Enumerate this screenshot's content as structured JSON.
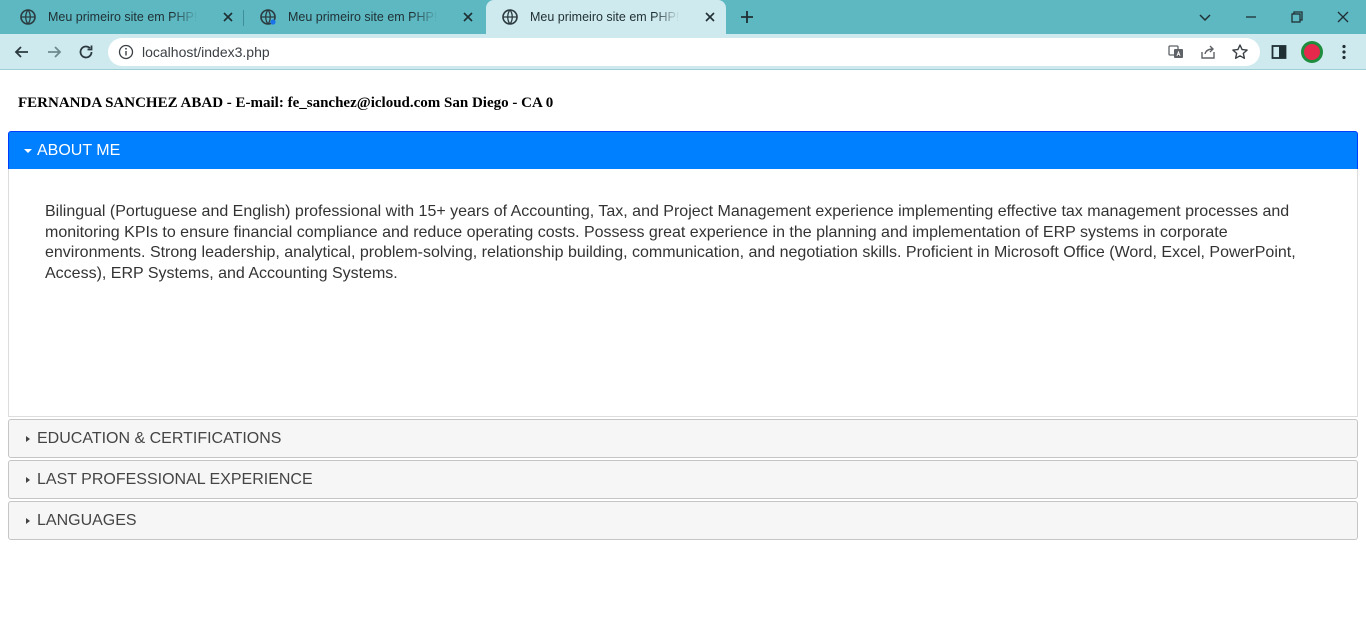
{
  "browser": {
    "tabs": [
      {
        "title": "Meu primeiro site em PHP! Wooh",
        "active": false
      },
      {
        "title": "Meu primeiro site em PHP! Wooh",
        "active": false
      },
      {
        "title": "Meu primeiro site em PHP! Wooh",
        "active": true
      }
    ],
    "address": "localhost/index3.php",
    "colors": {
      "tabstrip": "#5db8c2",
      "toolbar": "#cfeaee"
    }
  },
  "page": {
    "header": "FERNANDA SANCHEZ ABAD - E-mail: fe_sanchez@icloud.com San Diego - CA 0",
    "accordion": [
      {
        "title": "ABOUT ME",
        "expanded": true,
        "content": "Bilingual (Portuguese and English) professional with 15+ years of Accounting, Tax, and Project Management experience implementing effective tax management processes and monitoring KPIs to ensure financial compliance and reduce operating costs. Possess great experience in the planning and implementation of ERP systems in corporate environments. Strong leadership, analytical, problem-solving, relationship building, communication, and negotiation skills. Proficient in Microsoft Office (Word, Excel, PowerPoint, Access), ERP Systems, and Accounting Systems."
      },
      {
        "title": "EDUCATION & CERTIFICATIONS",
        "expanded": false
      },
      {
        "title": "LAST PROFESSIONAL EXPERIENCE",
        "expanded": false
      },
      {
        "title": "LANGUAGES",
        "expanded": false
      }
    ],
    "colors": {
      "active_header": "#007fff",
      "collapsed_header": "#f6f6f6"
    }
  }
}
